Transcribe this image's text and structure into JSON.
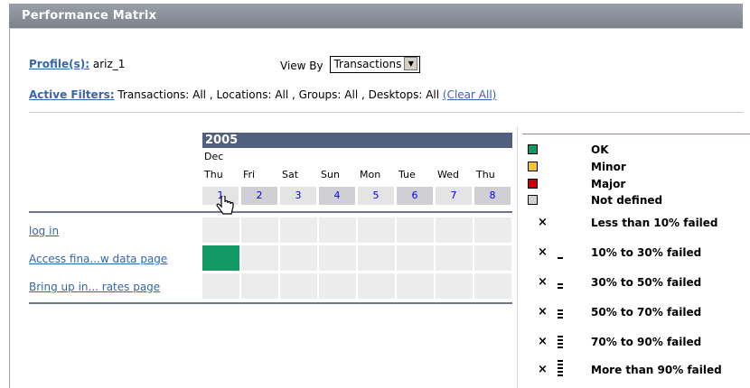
{
  "title": "Performance Matrix",
  "profile": {
    "label": "Profile(s):",
    "value": "ariz_1"
  },
  "view_by": {
    "label": "View By",
    "selected": "Transactions"
  },
  "filters": {
    "label": "Active Filters:",
    "text": "Transactions: All , Locations: All , Groups: All , Desktops: All",
    "clear": "(Clear All)"
  },
  "calendar": {
    "year": "2005",
    "month": "Dec",
    "days": [
      {
        "name": "Thu",
        "num": "1"
      },
      {
        "name": "Fri",
        "num": "2"
      },
      {
        "name": "Sat",
        "num": "3"
      },
      {
        "name": "Sun",
        "num": "4"
      },
      {
        "name": "Mon",
        "num": "5"
      },
      {
        "name": "Tue",
        "num": "6"
      },
      {
        "name": "Wed",
        "num": "7"
      },
      {
        "name": "Thu",
        "num": "8"
      }
    ]
  },
  "transactions": [
    {
      "label": "log in",
      "status": [
        "none",
        "none",
        "none",
        "none",
        "none",
        "none",
        "none",
        "none"
      ]
    },
    {
      "label": "Access fina...w data page",
      "status": [
        "ok",
        "none",
        "none",
        "none",
        "none",
        "none",
        "none",
        "none"
      ]
    },
    {
      "label": "Bring up in... rates page",
      "status": [
        "none",
        "none",
        "none",
        "none",
        "none",
        "none",
        "none",
        "none"
      ]
    }
  ],
  "legend": {
    "status": [
      {
        "label": "OK",
        "color": "#119966"
      },
      {
        "label": "Minor",
        "color": "#f2c431"
      },
      {
        "label": "Major",
        "color": "#cc0000"
      },
      {
        "label": "Not defined",
        "color": "#d0d0d0"
      }
    ],
    "failure": [
      {
        "label": "Less than 10% failed",
        "bars": 0
      },
      {
        "label": "10% to 30% failed",
        "bars": 1
      },
      {
        "label": "30% to 50% failed",
        "bars": 2
      },
      {
        "label": "50% to 70% failed",
        "bars": 3
      },
      {
        "label": "70% to 90% failed",
        "bars": 4
      },
      {
        "label": "More than 90% failed",
        "bars": 5
      }
    ],
    "x_symbol": "×"
  }
}
